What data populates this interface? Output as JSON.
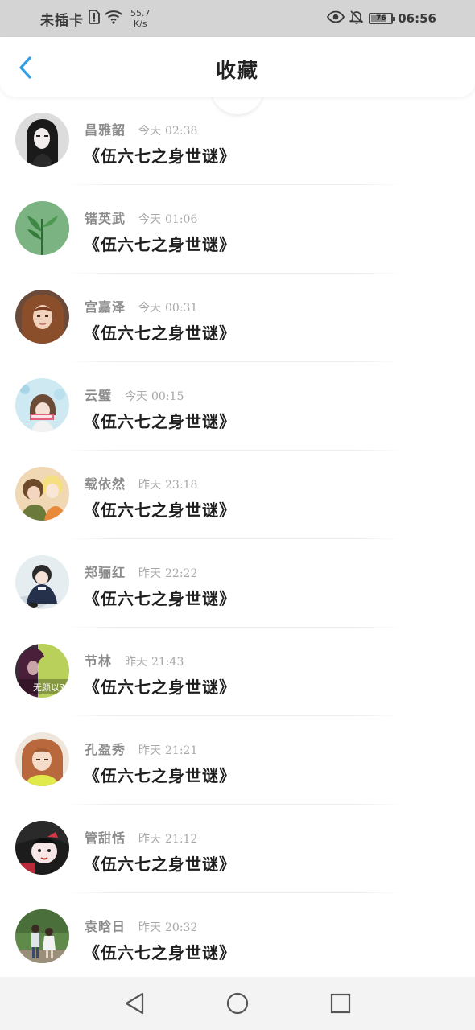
{
  "status_bar": {
    "carrier": "未插卡",
    "speed_value": "55.7",
    "speed_unit": "K/s",
    "battery": "76",
    "battery_level": 0.76,
    "time": "06:56",
    "icons": [
      "sim-alert-icon",
      "wifi-icon",
      "eye-comfort-icon",
      "bell-off-icon",
      "battery-icon"
    ]
  },
  "header": {
    "title": "收藏",
    "back_icon": "chevron-left-icon",
    "accent_color": "#2f9ee5"
  },
  "favorites": [
    {
      "author": "昌雅韶",
      "day": "今天",
      "time": "02:38",
      "title": "《伍六七之身世谜》",
      "avatar": "dark-hair-girl"
    },
    {
      "author": "锴英武",
      "day": "今天",
      "time": "01:06",
      "title": "《伍六七之身世谜》",
      "avatar": "green-plant"
    },
    {
      "author": "宫嘉泽",
      "day": "今天",
      "time": "00:31",
      "title": "《伍六七之身世谜》",
      "avatar": "girl-long-hair"
    },
    {
      "author": "云璧",
      "day": "今天",
      "time": "00:15",
      "title": "《伍六七之身世谜》",
      "avatar": "girl-light-blue"
    },
    {
      "author": "载依然",
      "day": "昨天",
      "time": "23:18",
      "title": "《伍六七之身世谜》",
      "avatar": "anime-couple"
    },
    {
      "author": "郑骊红",
      "day": "昨天",
      "time": "22:22",
      "title": "《伍六七之身世谜》",
      "avatar": "child-dark-coat"
    },
    {
      "author": "节林",
      "day": "昨天",
      "time": "21:43",
      "title": "《伍六七之身世谜》",
      "avatar": "purple-portrait",
      "avatar_text": "无颜以对"
    },
    {
      "author": "孔盈秀",
      "day": "昨天",
      "time": "21:21",
      "title": "《伍六七之身世谜》",
      "avatar": "girl-yellow"
    },
    {
      "author": "管甜恬",
      "day": "昨天",
      "time": "21:12",
      "title": "《伍六七之身世谜》",
      "avatar": "girl-black-red"
    },
    {
      "author": "袁晗日",
      "day": "昨天",
      "time": "20:32",
      "title": "《伍六七之身世谜》",
      "avatar": "couple-outdoor"
    }
  ],
  "nav_bar": {
    "buttons": [
      "back-triangle-icon",
      "home-circle-icon",
      "recents-square-icon"
    ]
  }
}
